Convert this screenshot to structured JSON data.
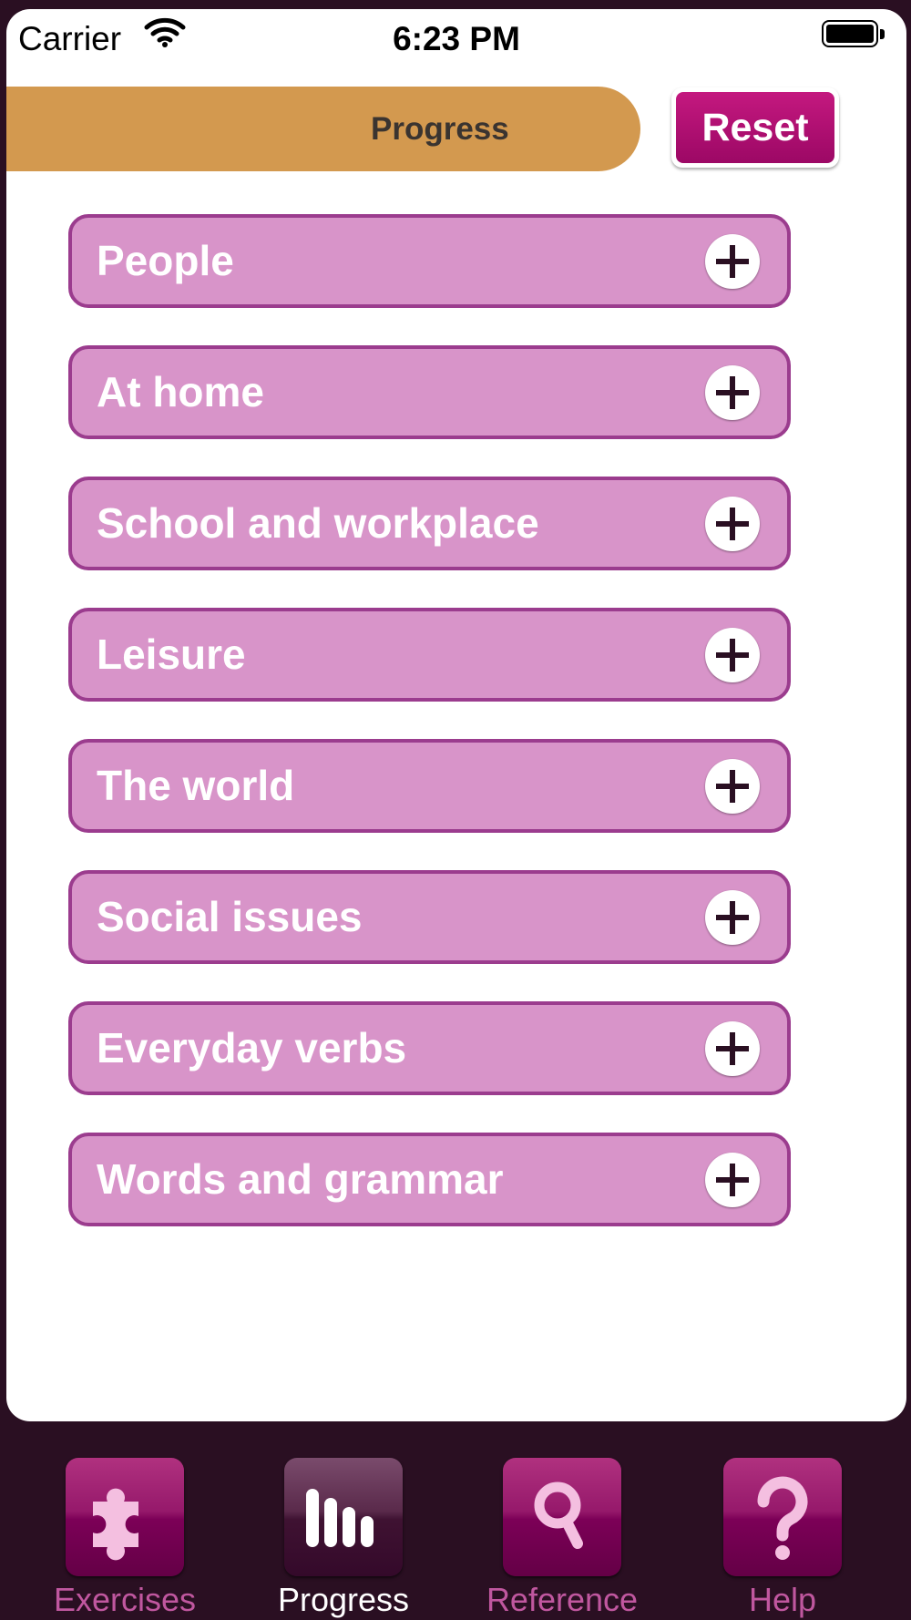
{
  "status_bar": {
    "carrier": "Carrier",
    "time": "6:23 PM"
  },
  "header": {
    "title": "Progress",
    "reset_label": "Reset",
    "bar_color": "#d3994f",
    "accent_color": "#a80a6d"
  },
  "categories": [
    {
      "label": "People",
      "icon": "plus-icon"
    },
    {
      "label": "At home",
      "icon": "plus-icon"
    },
    {
      "label": "School and workplace",
      "icon": "plus-icon"
    },
    {
      "label": "Leisure",
      "icon": "plus-icon"
    },
    {
      "label": "The world",
      "icon": "plus-icon"
    },
    {
      "label": "Social issues",
      "icon": "plus-icon"
    },
    {
      "label": "Everyday verbs",
      "icon": "plus-icon"
    },
    {
      "label": "Words and grammar",
      "icon": "plus-icon"
    }
  ],
  "tabs": [
    {
      "label": "Exercises",
      "icon": "puzzle-icon",
      "active": false
    },
    {
      "label": "Progress",
      "icon": "bar-chart-icon",
      "active": true
    },
    {
      "label": "Reference",
      "icon": "magnifier-icon",
      "active": false
    },
    {
      "label": "Help",
      "icon": "question-mark-icon",
      "active": false
    }
  ]
}
